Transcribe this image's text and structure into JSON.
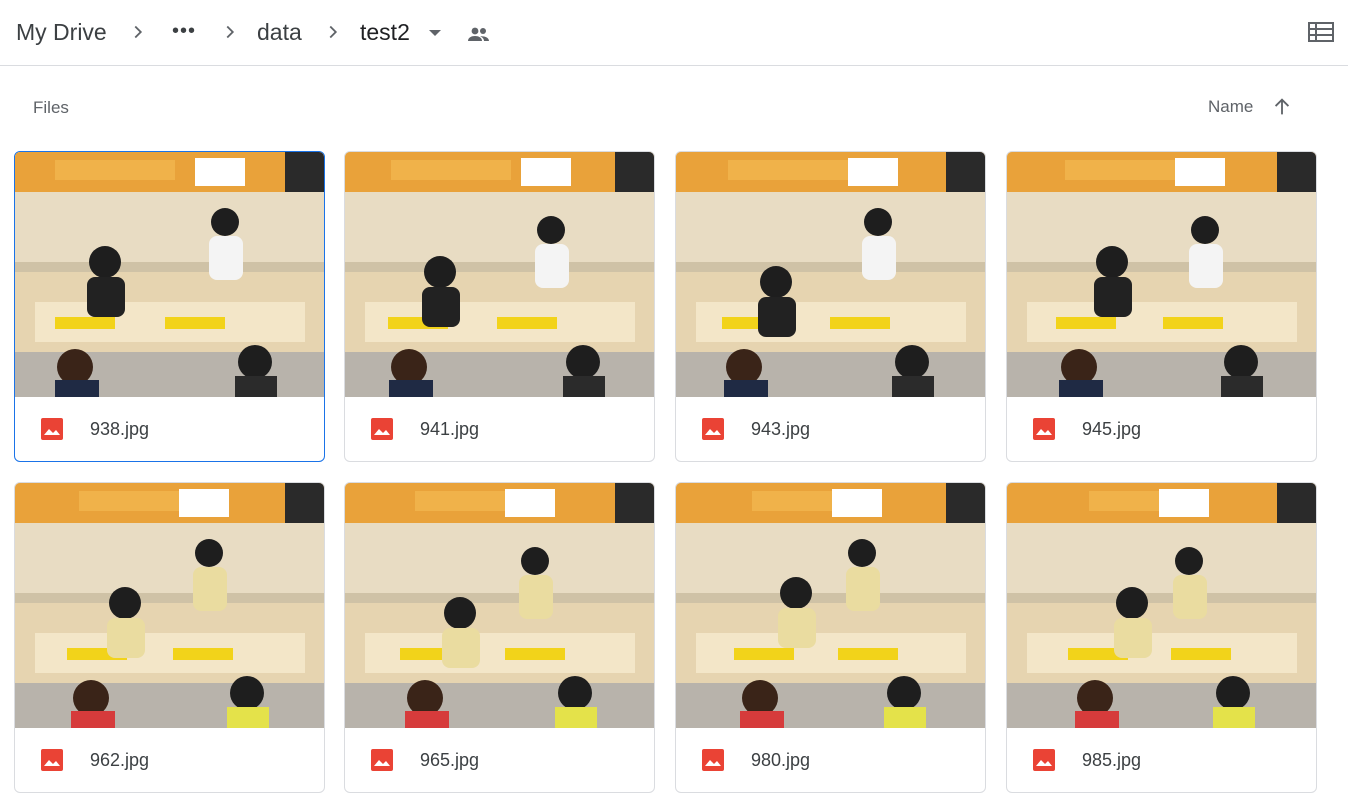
{
  "breadcrumb": {
    "root": "My Drive",
    "more": "•••",
    "folder1": "data",
    "current": "test2"
  },
  "section": {
    "files_label": "Files"
  },
  "sort": {
    "label": "Name",
    "direction": "ascending"
  },
  "accent_colors": {
    "selected_border": "#1a73e8",
    "image_icon": "#ea4335"
  },
  "files": [
    {
      "name": "938.jpg",
      "selected": true
    },
    {
      "name": "941.jpg",
      "selected": false
    },
    {
      "name": "943.jpg",
      "selected": false
    },
    {
      "name": "945.jpg",
      "selected": false
    },
    {
      "name": "962.jpg",
      "selected": false
    },
    {
      "name": "965.jpg",
      "selected": false
    },
    {
      "name": "980.jpg",
      "selected": false
    },
    {
      "name": "985.jpg",
      "selected": false
    }
  ]
}
